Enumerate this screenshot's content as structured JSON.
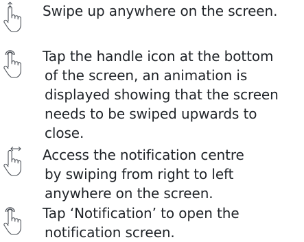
{
  "instructions": [
    {
      "icon": "swipe-up-hand-icon",
      "lines": [
        "Swipe up anywhere on the screen."
      ]
    },
    {
      "icon": "tap-hand-icon",
      "lines": [
        "Tap the handle icon at the bottom",
        "of the screen, an animation is",
        "displayed showing that the screen",
        "needs to be swiped upwards to",
        "close."
      ]
    },
    {
      "icon": "swipe-horizontal-hand-icon",
      "lines": [
        "Access the notification centre",
        "by swiping from right to left",
        "anywhere on the screen."
      ]
    },
    {
      "icon": "tap-hand-icon",
      "lines": [
        "Tap ‘Notification’ to open the",
        "notification screen."
      ]
    }
  ]
}
